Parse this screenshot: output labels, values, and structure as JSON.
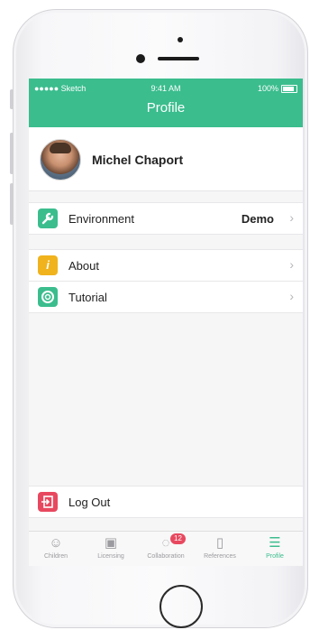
{
  "status_bar": {
    "carrier": "●●●●● Sketch",
    "time": "9:41 AM",
    "battery": "100%"
  },
  "nav": {
    "title": "Profile"
  },
  "profile": {
    "name": "Michel Chaport"
  },
  "rows": {
    "environment": {
      "label": "Environment",
      "value": "Demo",
      "icon": "wrench-icon",
      "color": "#3bbd8e"
    },
    "about": {
      "label": "About",
      "icon": "info-icon",
      "color": "#f0b31d"
    },
    "tutorial": {
      "label": "Tutorial",
      "icon": "lifebuoy-icon",
      "color": "#3bbd8e"
    },
    "logout": {
      "label": "Log Out",
      "icon": "logout-icon",
      "color": "#e8485f"
    }
  },
  "tabs": [
    {
      "label": "Children",
      "icon": "child-face-icon"
    },
    {
      "label": "Licensing",
      "icon": "certificate-icon"
    },
    {
      "label": "Collaboration",
      "icon": "chat-bubble-icon",
      "badge": "12"
    },
    {
      "label": "References",
      "icon": "phone-outline-icon"
    },
    {
      "label": "Profile",
      "icon": "hamburger-menu-icon"
    }
  ],
  "colors": {
    "accent": "#3bbd8e",
    "badge": "#e8485f"
  }
}
